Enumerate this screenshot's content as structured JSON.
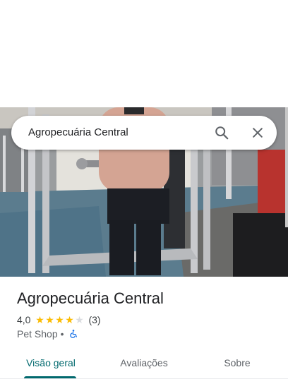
{
  "search": {
    "query": "Agropecuária Central",
    "search_icon": "search-icon",
    "close_icon": "close-icon"
  },
  "place": {
    "name": "Agropecuária Central",
    "rating": "4,0",
    "rating_value": 4.0,
    "rating_max": 5,
    "review_count": "(3)",
    "category": "Pet Shop",
    "separator": "•",
    "accessibility_icon": "wheelchair-accessible-icon"
  },
  "tabs": [
    {
      "label": "Visão geral",
      "active": true
    },
    {
      "label": "Avaliações",
      "active": false
    },
    {
      "label": "Sobre",
      "active": false
    }
  ],
  "colors": {
    "accent": "#01696e",
    "star": "#fbbc04",
    "accessibility": "#1a73e8"
  }
}
